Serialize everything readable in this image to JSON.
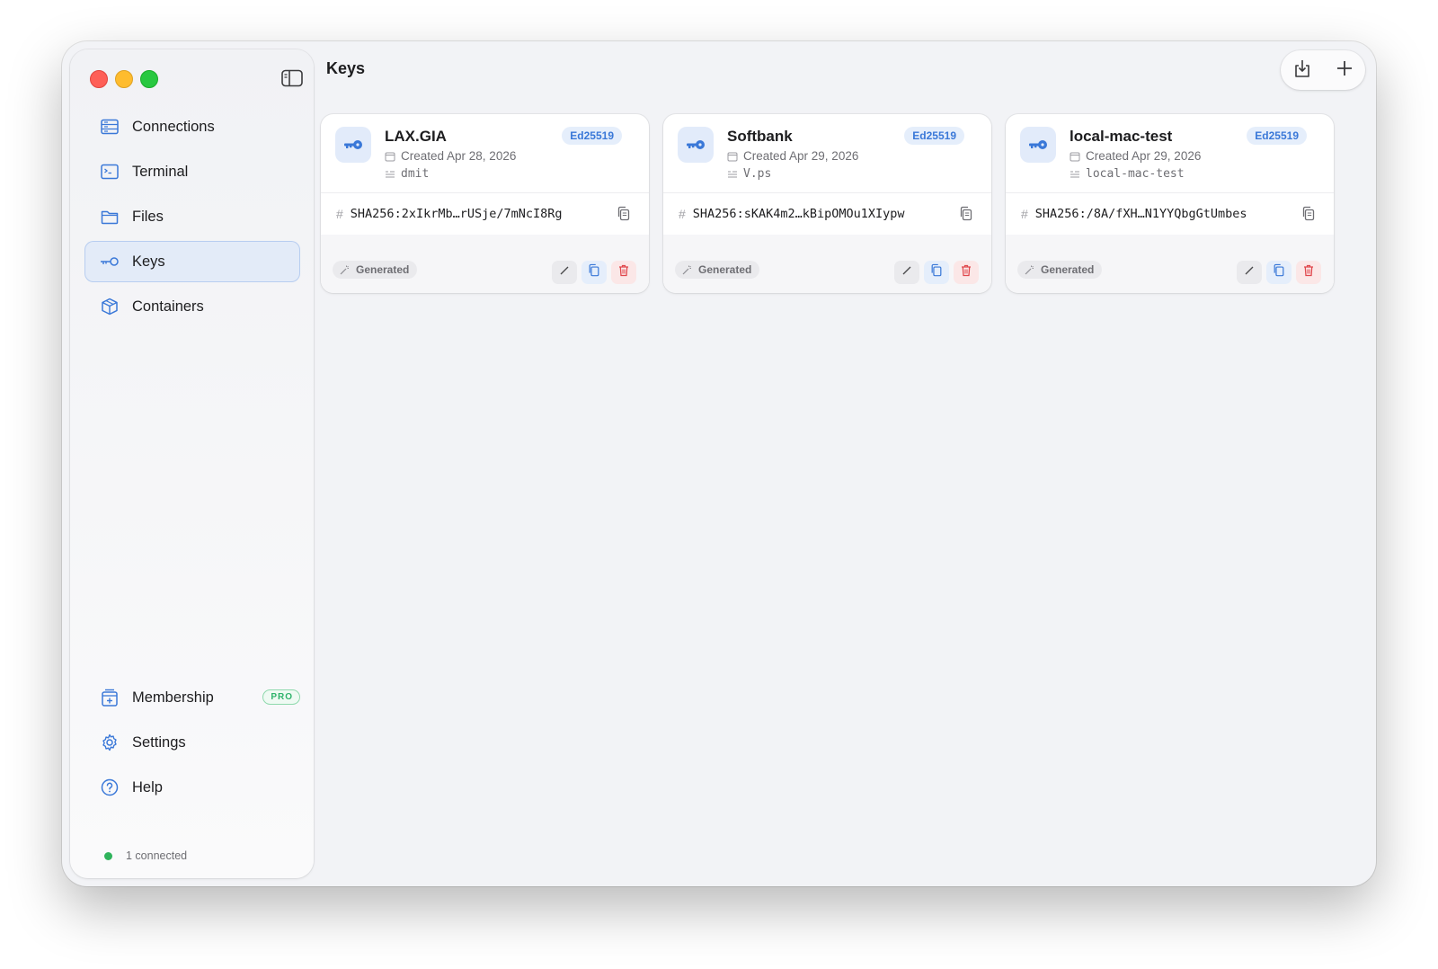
{
  "page": {
    "title": "Keys"
  },
  "sidebar": {
    "items": [
      {
        "label": "Connections",
        "icon": "server-icon"
      },
      {
        "label": "Terminal",
        "icon": "terminal-icon"
      },
      {
        "label": "Files",
        "icon": "folder-icon"
      },
      {
        "label": "Keys",
        "icon": "key-icon",
        "active": true
      },
      {
        "label": "Containers",
        "icon": "cube-icon"
      }
    ],
    "bottom_items": [
      {
        "label": "Membership",
        "icon": "membership-icon",
        "badge": "PRO"
      },
      {
        "label": "Settings",
        "icon": "gear-icon"
      },
      {
        "label": "Help",
        "icon": "help-icon"
      }
    ],
    "status": {
      "text": "1 connected",
      "color": "#2fb35b"
    }
  },
  "toolbar": {
    "import_icon": "import-icon",
    "add_icon": "plus-icon"
  },
  "keys": [
    {
      "name": "LAX.GIA",
      "algorithm": "Ed25519",
      "created": "Created Apr 28, 2026",
      "comment": "dmit",
      "fingerprint": "SHA256:2xIkrMb…rUSje/7mNcI8Rg",
      "origin": "Generated"
    },
    {
      "name": "Softbank",
      "algorithm": "Ed25519",
      "created": "Created Apr 29, 2026",
      "comment": "V.ps",
      "fingerprint": "SHA256:sKAK4m2…kBipOMOu1XIypw",
      "origin": "Generated"
    },
    {
      "name": "local-mac-test",
      "algorithm": "Ed25519",
      "created": "Created Apr 29, 2026",
      "comment": "local-mac-test",
      "fingerprint": "SHA256:/8A/fXH…N1YYQbgGtUmbes",
      "origin": "Generated"
    }
  ],
  "colors": {
    "accent": "#3a78d8",
    "danger": "#e0474c",
    "success": "#2fb35b"
  }
}
